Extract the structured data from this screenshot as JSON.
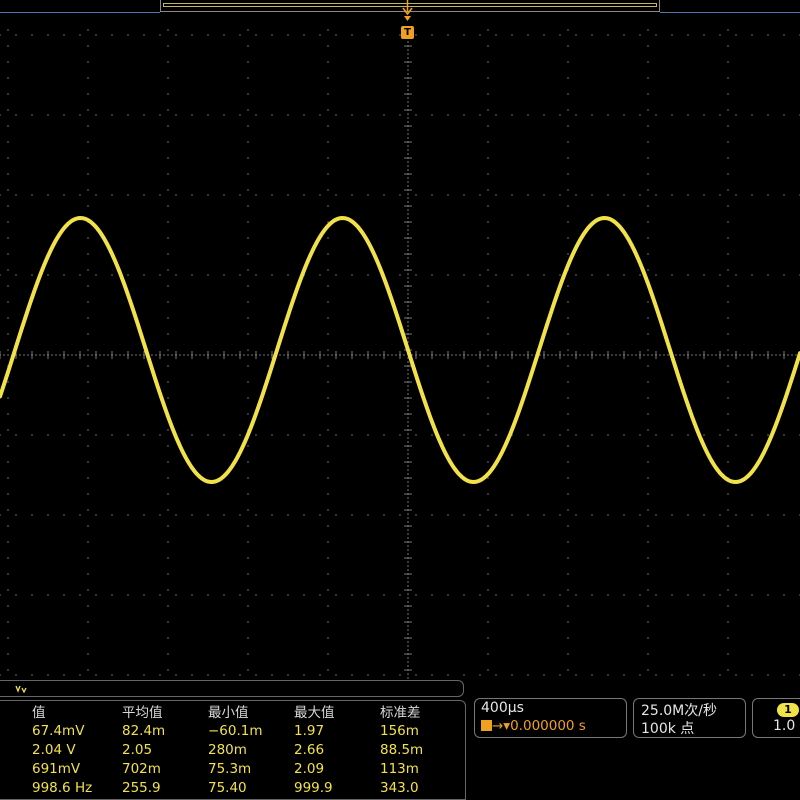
{
  "scope": {
    "trigger_label": "T",
    "channel_color": "#f2e24a",
    "grid": true,
    "waveform": {
      "type": "sine",
      "cycles_on_screen": 3.1,
      "phase_at_center_deg": 180
    }
  },
  "measurements": {
    "header_icon": "channel-1-glyph",
    "columns": [
      "值",
      "平均值",
      "最小值",
      "最大值",
      "标准差"
    ],
    "rows": [
      [
        "67.4mV",
        "82.4m",
        "−60.1m",
        "1.97",
        "156m"
      ],
      [
        "2.04 V",
        "2.05",
        "280m",
        "2.66",
        "88.5m"
      ],
      [
        "691mV",
        "702m",
        "75.3m",
        "2.09",
        "113m"
      ],
      [
        "998.6 Hz",
        "255.9",
        "75.40",
        "999.9",
        "343.0"
      ]
    ]
  },
  "horizontal": {
    "scale": "400µs",
    "delay": "0.000000 s"
  },
  "acquisition": {
    "sample_rate": "25.0M次/秒",
    "record_length": "100k 点"
  },
  "channel": {
    "badge": "1",
    "value": "1.0"
  }
}
